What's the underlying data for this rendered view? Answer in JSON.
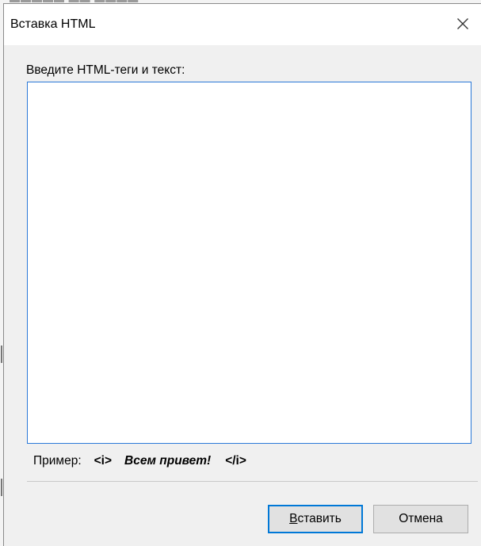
{
  "dialog": {
    "title": "Вставка HTML",
    "close_icon": "close-x-icon",
    "prompt_label": "Введите HTML-теги и текст:",
    "textarea_value": "",
    "example": {
      "label": "Пример:",
      "open_tag": "<i>",
      "text": "Всем привет!",
      "close_tag": "</i>"
    },
    "buttons": {
      "insert": {
        "accelerator": "В",
        "rest": "ставить"
      },
      "cancel": "Отмена"
    }
  },
  "colors": {
    "dialog_bg": "#f0f0f0",
    "title_bg": "#ffffff",
    "focus_border": "#2a78d8",
    "default_button_border": "#0078d7",
    "button_bg": "#e1e1e1"
  }
}
